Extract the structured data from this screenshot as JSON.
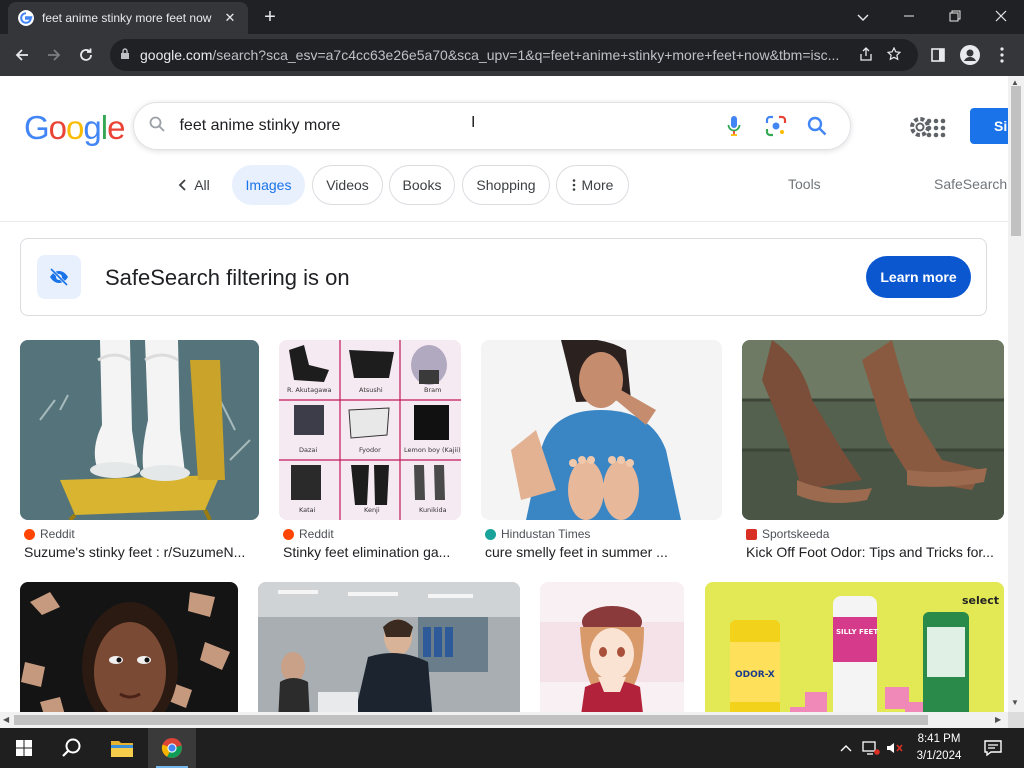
{
  "browser": {
    "tab_title": "feet anime stinky more feet now",
    "tab_close": "✕",
    "new_tab": "+",
    "url_domain": "google.com",
    "url_rest": "/search?sca_esv=a7c4cc63e26e5a70&sca_upv=1&q=feet+anime+stinky+more+feet+now&tbm=isc..."
  },
  "google": {
    "logo": "Google",
    "query": "feet anime stinky more",
    "signin_label": "Si",
    "chips": [
      "All",
      "Images",
      "Videos",
      "Books",
      "Shopping",
      "More"
    ],
    "tools_label": "Tools",
    "safesearch_label": "SafeSearch",
    "safe_banner": "SafeSearch filtering is on",
    "learn_more": "Learn more"
  },
  "results": [
    {
      "source": "Reddit",
      "caption": "Suzume's stinky feet : r/SuzumeN...",
      "source_color": "#ff4500"
    },
    {
      "source": "Reddit",
      "caption": "Stinky feet elimination ga...",
      "source_color": "#ff4500"
    },
    {
      "source": "Hindustan Times",
      "caption": "cure smelly feet in summer ...",
      "source_color": "#1aa39a"
    },
    {
      "source": "Sportskeeda",
      "caption": "Kick Off Foot Odor: Tips and Tricks for...",
      "source_color": "#d93025"
    }
  ],
  "grid_labels": [
    "R. Akutagawa",
    "Atsushi",
    "Bram",
    "Dazai",
    "Fyodor",
    "Lemon boy (Kajii)",
    "Katai",
    "Kenji",
    "Kunikida"
  ],
  "product_labels": {
    "brand": "select",
    "silly": "SILLY FEET",
    "odorx": "ODOR-X"
  },
  "taskbar": {
    "time": "8:41 PM",
    "date": "3/1/2024"
  }
}
